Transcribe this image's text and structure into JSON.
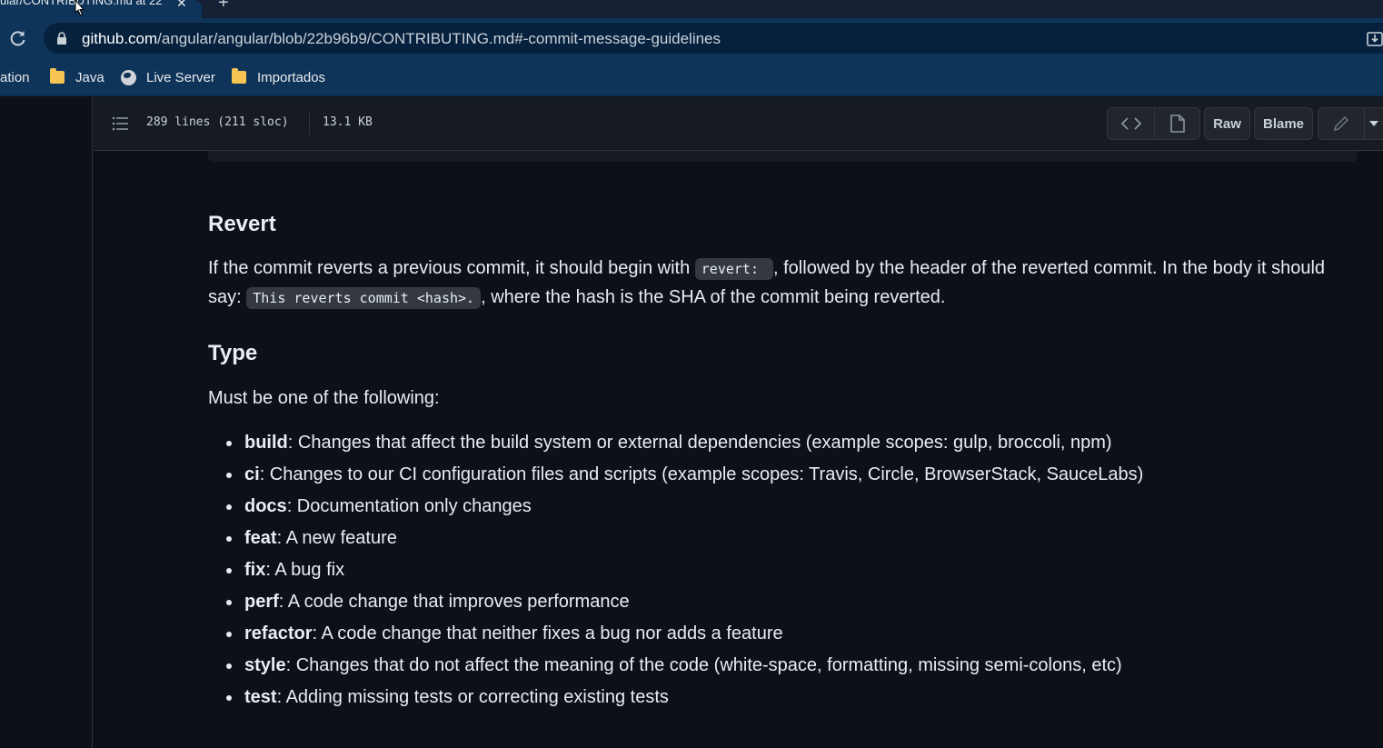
{
  "browser": {
    "tab_title": "ular/CONTRIBUTING.md at 22",
    "url_host": "github.com",
    "url_path": "/angular/angular/blob/22b96b9/CONTRIBUTING.md#-commit-message-guidelines",
    "bookmarks": [
      {
        "label": "ation",
        "icon": "none"
      },
      {
        "label": "Java",
        "icon": "folder-icon"
      },
      {
        "label": "Live Server",
        "icon": "globe-icon"
      },
      {
        "label": "Importados",
        "icon": "folder-icon"
      }
    ]
  },
  "file_header": {
    "lines_info": "289 lines (211 sloc)",
    "size": "13.1 KB",
    "raw_label": "Raw",
    "blame_label": "Blame"
  },
  "content": {
    "revert_heading": "Revert",
    "revert_text_1": "If the commit reverts a previous commit, it should begin with ",
    "revert_code_1": "revert: ",
    "revert_text_2": ", followed by the header of the reverted commit. In the body it should say: ",
    "revert_code_2": "This reverts commit <hash>.",
    "revert_text_3": ", where the hash is the SHA of the commit being reverted.",
    "type_heading": "Type",
    "type_intro": "Must be one of the following:",
    "types": [
      {
        "name": "build",
        "desc": ": Changes that affect the build system or external dependencies (example scopes: gulp, broccoli, npm)"
      },
      {
        "name": "ci",
        "desc": ": Changes to our CI configuration files and scripts (example scopes: Travis, Circle, BrowserStack, SauceLabs)"
      },
      {
        "name": "docs",
        "desc": ": Documentation only changes"
      },
      {
        "name": "feat",
        "desc": ": A new feature"
      },
      {
        "name": "fix",
        "desc": ": A bug fix"
      },
      {
        "name": "perf",
        "desc": ": A code change that improves performance"
      },
      {
        "name": "refactor",
        "desc": ": A code change that neither fixes a bug nor adds a feature"
      },
      {
        "name": "style",
        "desc": ": Changes that do not affect the meaning of the code (white-space, formatting, missing semi-colons, etc)"
      },
      {
        "name": "test",
        "desc": ": Adding missing tests or correcting existing tests"
      }
    ]
  }
}
